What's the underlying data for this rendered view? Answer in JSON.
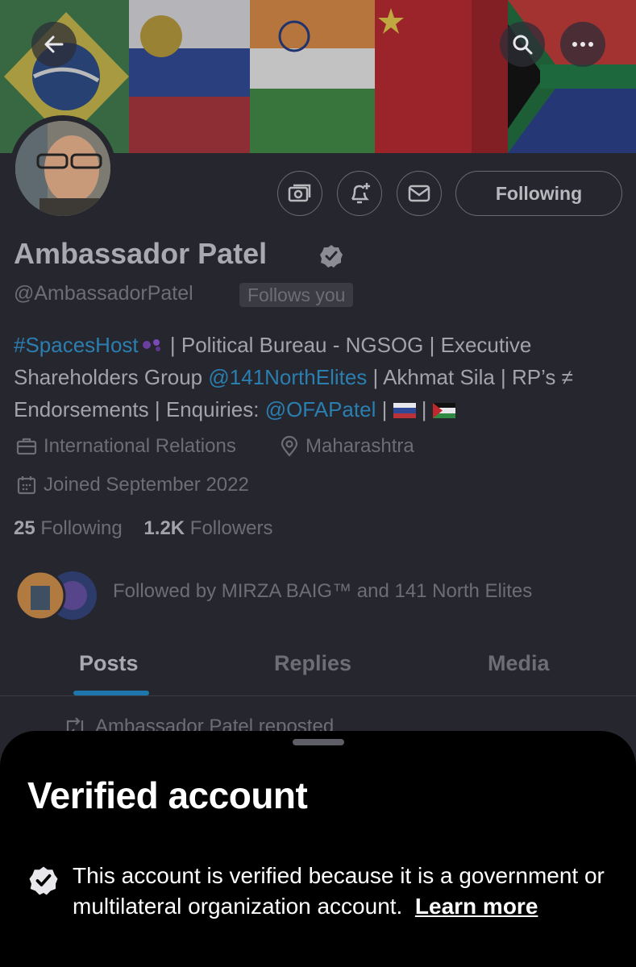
{
  "profile": {
    "name": "Ambassador Patel",
    "handle": "@AmbassadorPatel",
    "follows_you": "Follows you",
    "following_button": "Following",
    "bio": {
      "tag": "#SpacesHost",
      "part1": " | Political Bureau - NGSOG | Executive Shareholders Group ",
      "mention1": "@141NorthElites",
      "part2": " | Akhmat Sila | RP’s ≠ Endorsements | Enquiries: ",
      "mention2": "@OFAPatel",
      "sep1": " | ",
      "sep2": " | "
    },
    "category": "International Relations",
    "location": "Maharashtra",
    "joined": "Joined September 2022",
    "following_count": "25",
    "following_label": " Following",
    "followers_count": "1.2K",
    "followers_label": " Followers",
    "followed_by": "Followed by MIRZA BAIG™ and 141 North Elites"
  },
  "tabs": [
    "Posts",
    "Replies",
    "Media"
  ],
  "feed": {
    "repost_text": "Ambassador Patel reposted"
  },
  "sheet": {
    "title": "Verified account",
    "text": "This account is verified because it is a government or multilateral organization account.",
    "learn_more": "Learn more"
  },
  "icons": {
    "back": "back-arrow-icon",
    "search": "search-icon",
    "more": "more-icon",
    "subscribe": "subscribe-icon",
    "notify": "bell-plus-icon",
    "message": "envelope-icon",
    "verified": "verified-badge-icon",
    "category": "briefcase-icon",
    "location": "location-pin-icon",
    "joined": "calendar-icon",
    "repost": "repost-icon"
  },
  "colors": {
    "background": "#26262e",
    "link": "#2a7fb0",
    "tab_indicator": "#1d77ad",
    "sheet_background": "#000000"
  }
}
